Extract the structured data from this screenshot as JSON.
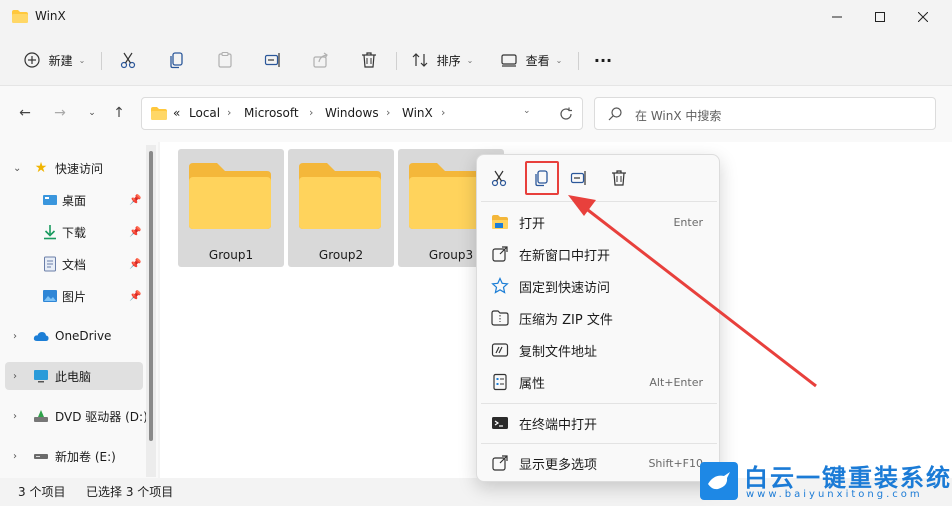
{
  "window": {
    "title": "WinX"
  },
  "toolbar": {
    "new_label": "新建",
    "sort_label": "排序",
    "view_label": "查看",
    "more_label": "···"
  },
  "address": {
    "overflow": "«",
    "crumbs": [
      "Local",
      "Microsoft",
      "Windows",
      "WinX"
    ]
  },
  "search": {
    "placeholder": "在 WinX 中搜索"
  },
  "sidebar": {
    "items": [
      {
        "label": "快速访问"
      },
      {
        "label": "桌面"
      },
      {
        "label": "下载"
      },
      {
        "label": "文档"
      },
      {
        "label": "图片"
      },
      {
        "label": "OneDrive"
      },
      {
        "label": "此电脑"
      },
      {
        "label": "DVD 驱动器 (D:)"
      },
      {
        "label": "新加卷 (E:)"
      }
    ]
  },
  "folders": [
    {
      "name": "Group1"
    },
    {
      "name": "Group2"
    },
    {
      "name": "Group3"
    }
  ],
  "status": {
    "count": "3 个项目",
    "selected": "已选择 3 个项目"
  },
  "context_menu": {
    "items": [
      {
        "label": "打开",
        "shortcut": "Enter"
      },
      {
        "label": "在新窗口中打开",
        "shortcut": ""
      },
      {
        "label": "固定到快速访问",
        "shortcut": ""
      },
      {
        "label": "压缩为 ZIP 文件",
        "shortcut": ""
      },
      {
        "label": "复制文件地址",
        "shortcut": ""
      },
      {
        "label": "属性",
        "shortcut": "Alt+Enter"
      },
      {
        "label": "在终端中打开",
        "shortcut": ""
      },
      {
        "label": "显示更多选项",
        "shortcut": "Shift+F10"
      }
    ]
  },
  "watermark": {
    "text": "白云一键重装系统",
    "url": "www.baiyunxitong.com"
  },
  "colors": {
    "accent": "#0067c0",
    "folder": "#ffc83d",
    "highlight_red": "#e8403c",
    "selection": "#d9d9d9"
  }
}
